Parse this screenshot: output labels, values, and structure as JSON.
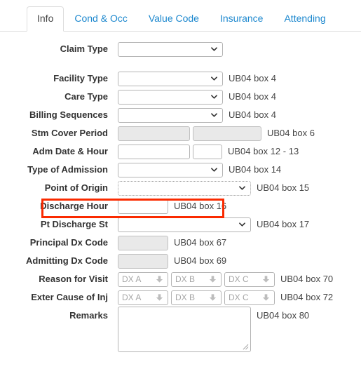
{
  "tabs": [
    {
      "label": "Info",
      "active": true
    },
    {
      "label": "Cond & Occ",
      "active": false
    },
    {
      "label": "Value Code",
      "active": false
    },
    {
      "label": "Insurance",
      "active": false
    },
    {
      "label": "Attending",
      "active": false
    }
  ],
  "form": {
    "rows": [
      {
        "label": "Claim Type",
        "note": ""
      },
      {
        "label": "Facility Type",
        "note": "UB04 box 4"
      },
      {
        "label": "Care Type",
        "note": "UB04 box 4"
      },
      {
        "label": "Billing Sequences",
        "note": "UB04 box 4"
      },
      {
        "label": "Stm Cover Period",
        "note": "UB04 box 6"
      },
      {
        "label": "Adm Date & Hour",
        "note": "UB04 box 12 - 13"
      },
      {
        "label": "Type of Admission",
        "note": "UB04 box 14"
      },
      {
        "label": "Point of Origin",
        "note": "UB04 box 15"
      },
      {
        "label": "Discharge Hour",
        "note": "UB04 box 16"
      },
      {
        "label": "Pt Discharge St",
        "note": "UB04 box 17"
      },
      {
        "label": "Principal Dx Code",
        "note": "UB04 box 67"
      },
      {
        "label": "Admitting Dx Code",
        "note": "UB04 box 69"
      },
      {
        "label": "Reason for Visit",
        "note": "UB04 box 70"
      },
      {
        "label": "Exter Cause of Inj",
        "note": "UB04 box 72"
      },
      {
        "label": "Remarks",
        "note": "UB04 box 80"
      }
    ],
    "values": {
      "claim_type": "",
      "facility_type": "",
      "care_type": "",
      "billing_sequences": "",
      "stm_cover_from": "",
      "stm_cover_to": "",
      "adm_date": "",
      "adm_hour": "",
      "type_of_admission": "",
      "point_of_origin": "",
      "discharge_hour": "",
      "pt_discharge_st": "",
      "principal_dx_code": "",
      "admitting_dx_code": "",
      "remarks": ""
    },
    "dx_placeholders": {
      "a": "DX A",
      "b": "DX B",
      "c": "DX C"
    }
  },
  "highlight": {
    "target_label": "Discharge Hour",
    "color": "#fa2a00"
  }
}
